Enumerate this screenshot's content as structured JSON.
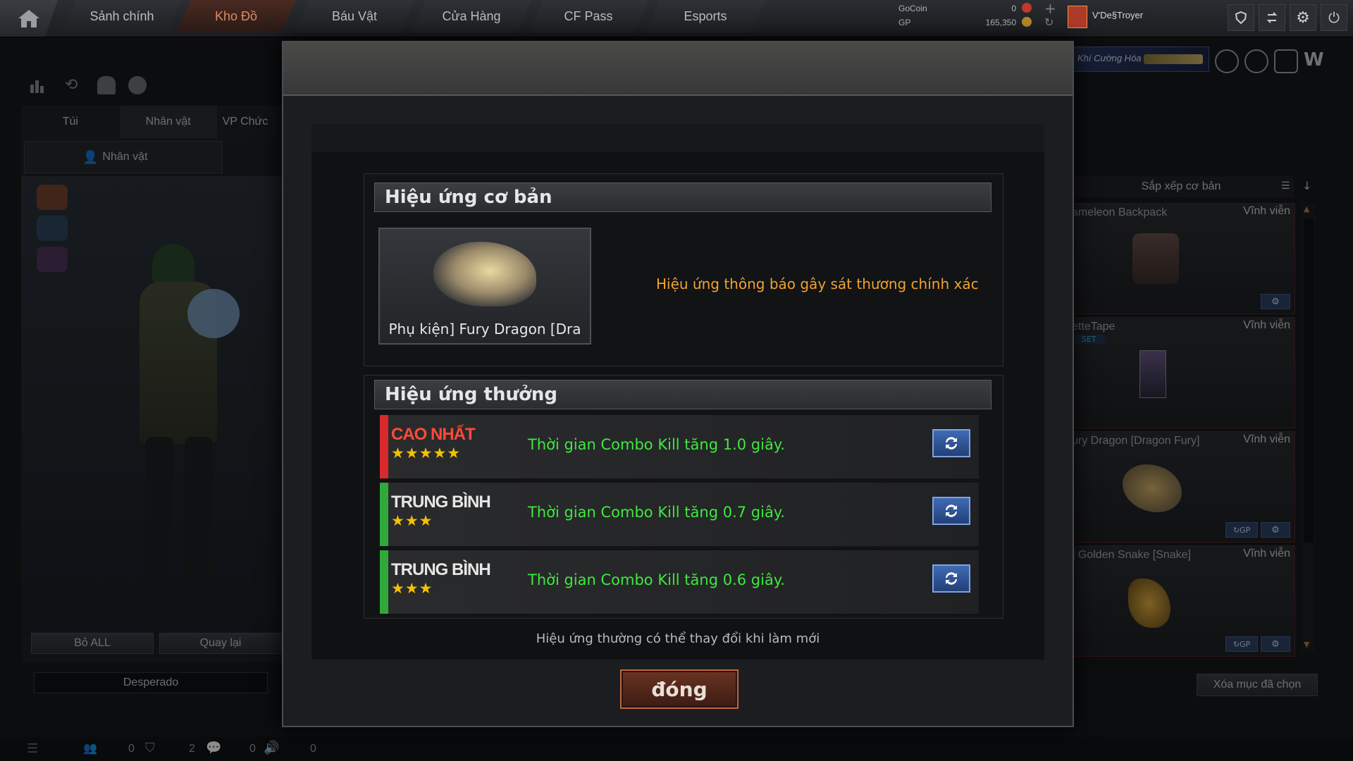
{
  "nav": {
    "tabs": [
      "Sảnh chính",
      "Kho Đồ",
      "Báu Vật",
      "Cửa Hàng",
      "CF Pass",
      "Esports"
    ],
    "active_index": 1
  },
  "currency": {
    "gocoin_label": "GoCoin",
    "gocoin_value": "0",
    "gp_label": "GP",
    "gp_value": "165,350"
  },
  "user": {
    "name": "V'De§Troyer"
  },
  "banner": {
    "text": "Khí Cường Hóa"
  },
  "left": {
    "tabs": [
      "Túi",
      "Nhân vật",
      "VP Chức"
    ],
    "subtab": "Nhân vật",
    "remove_all": "Bỏ ALL",
    "back": "Quay lại",
    "character_name": "Desperado"
  },
  "right": {
    "sort_label": "Sắp xếp cơ bản",
    "items": [
      {
        "name": "ameleon Backpack",
        "duration": "Vĩnh viễn"
      },
      {
        "name": "etteTape",
        "duration": "Vĩnh viễn",
        "badge": "SET"
      },
      {
        "name": "ury Dragon [Dragon Fury]",
        "duration": "Vĩnh viễn"
      },
      {
        "name": "] Golden Snake [Snake]",
        "duration": "Vĩnh viễn"
      }
    ],
    "clear_selected": "Xóa mục đã chọn"
  },
  "modal": {
    "basic_title": "Hiệu ứng cơ bản",
    "item_name": "Phụ kiện] Fury Dragon [Dra",
    "basic_effect": "Hiệu ứng thông báo gây sát thương chính xác",
    "bonus_title": "Hiệu ứng thưởng",
    "effects": [
      {
        "tier": "CAO NHẤT",
        "stars": "★★★★★",
        "text": "Thời gian Combo Kill tăng 1.0 giây.",
        "color": "#d82a2a",
        "tier_color": "#ff4a3a"
      },
      {
        "tier": "TRUNG BÌNH",
        "stars": "★★★",
        "text": "Thời gian Combo Kill tăng 0.7 giây.",
        "color": "#2faa3a",
        "tier_color": "#e6e6e6"
      },
      {
        "tier": "TRUNG BÌNH",
        "stars": "★★★",
        "text": "Thời gian Combo Kill tăng 0.6 giây.",
        "color": "#2faa3a",
        "tier_color": "#e6e6e6"
      }
    ],
    "note": "Hiệu ứng thường có thể thay đổi khi làm mới",
    "close": "đóng"
  },
  "bottom": {
    "counts": [
      "0",
      "2",
      "0",
      "0"
    ]
  }
}
